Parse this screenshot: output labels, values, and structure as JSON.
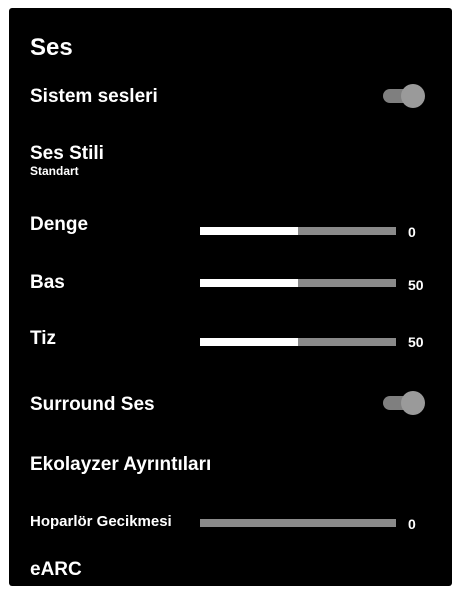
{
  "colors": {
    "panel_bg": "#000000",
    "text": "#ffffff",
    "toggle_track": "#7f7f7f",
    "toggle_knob": "#9a9a9a",
    "slider_fill": "#ffffff",
    "slider_rail": "#8a8a8a"
  },
  "menu": {
    "title": "Ses",
    "system_sounds": {
      "label": "Sistem sesleri",
      "enabled": true
    },
    "sound_style": {
      "label": "Ses Stili",
      "value": "Standart"
    },
    "balance": {
      "label": "Denge",
      "value": "0",
      "fill_fraction": 0.5
    },
    "bass": {
      "label": "Bas",
      "value": "50",
      "fill_fraction": 0.5
    },
    "treble": {
      "label": "Tiz",
      "value": "50",
      "fill_fraction": 0.5
    },
    "surround": {
      "label": "Surround Ses",
      "enabled": true
    },
    "equalizer": {
      "label": "Ekolayzer Ayrıntıları"
    },
    "speaker_delay": {
      "label": "Hoparlör Gecikmesi",
      "value": "0",
      "fill_fraction": 0.0
    },
    "earc": {
      "label": "eARC"
    }
  }
}
